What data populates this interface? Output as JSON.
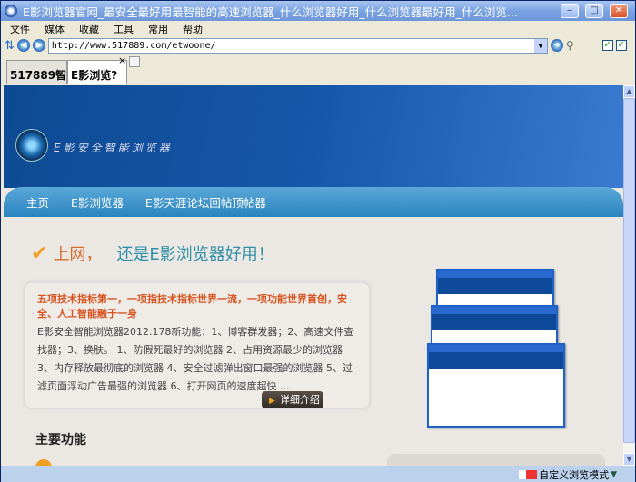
{
  "window": {
    "title": "E影浏览器官网_最安全最好用最智能的高速浏览器_什么浏览器好用_什么浏览器最好用_什么浏览...",
    "minimize": "‒",
    "maximize": "□",
    "close": "✕"
  },
  "menu": [
    "文件",
    "媒体",
    "收藏",
    "工具",
    "常用",
    "帮助"
  ],
  "address": {
    "url": "http://www.517889.com/etwoone/"
  },
  "tabs": [
    {
      "label": "517889智"
    },
    {
      "label": "E影浏览?"
    }
  ],
  "tab_close": "×",
  "page": {
    "logo_text": "E影安全智能浏览器",
    "nav": [
      "主页",
      "E影浏览器",
      "E影天涯论坛回帖顶帖器"
    ],
    "heading_a": "上网，",
    "heading_b": "还是E影浏览器好用！",
    "card": {
      "highlight": "五项技术指标第一，一项指技术指标世界一流，一项功能世界首创，安全、人工智能融于一身",
      "body": "E影安全智能浏览器2012.178新功能：1、博客群发器；2、高速文件查找器；3、换肤。 1、防假死最好的浏览器 2、占用资源最少的浏览器 3、内存释放最彻底的浏览器 4、安全过滤弹出窗口最强的浏览器 5、过滤页面浮动广告最强的浏览器 6、打开网页的速度超快 ...",
      "more": "详细介绍"
    },
    "features_title": "主要功能"
  },
  "status": {
    "mode": "自定义浏览模式"
  },
  "colors": {
    "accent_orange": "#d8531e",
    "header_blue": "#1557a8",
    "teal": "#2f8fa8"
  }
}
